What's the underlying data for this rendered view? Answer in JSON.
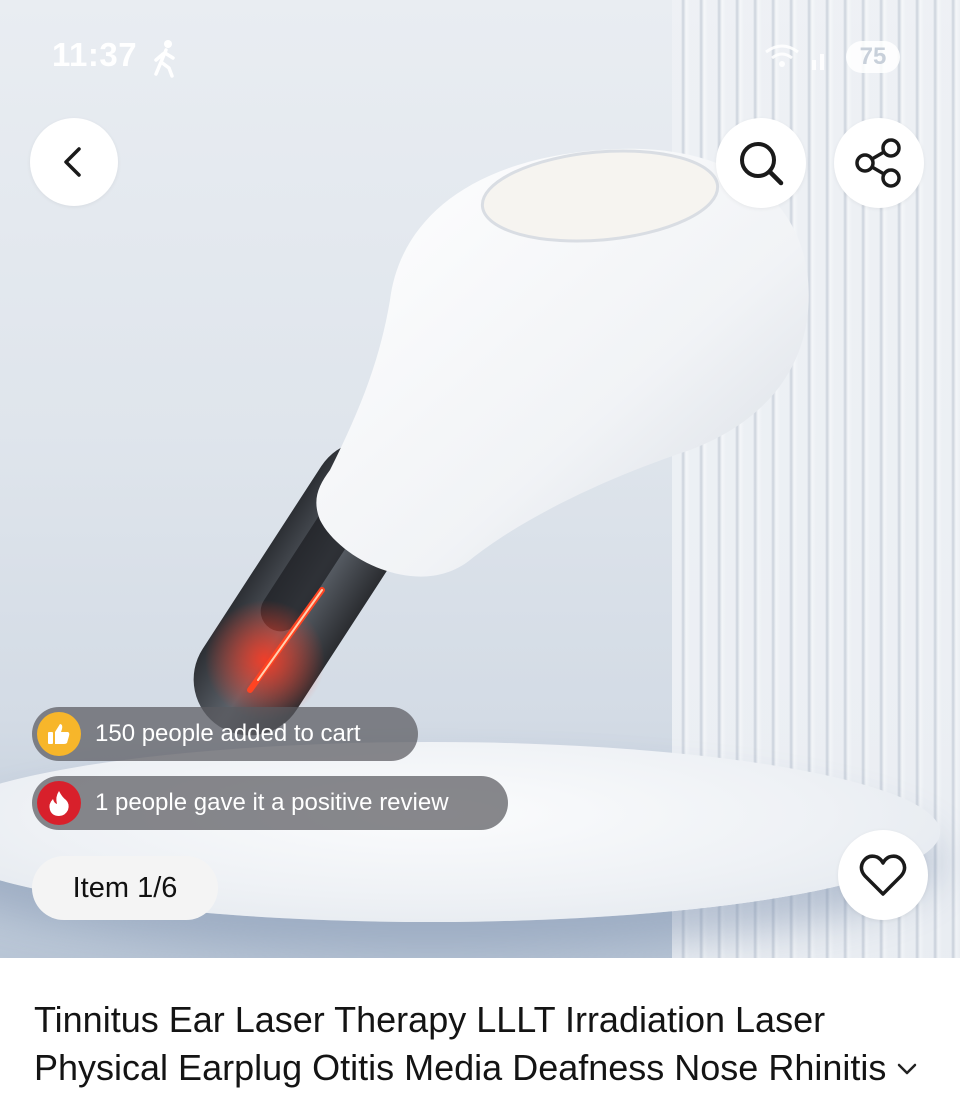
{
  "status_bar": {
    "time": "11:37",
    "activity_icon": "walking-person-icon",
    "wifi_icon": "wifi-icon",
    "signal_icon": "cell-signal-icon",
    "battery": "75"
  },
  "header": {
    "back_icon": "chevron-left-icon",
    "search_icon": "search-icon",
    "share_icon": "share-icon"
  },
  "product_image": {
    "description_icon": "product-photo"
  },
  "badges": {
    "cart_icon": "thumbs-up-icon",
    "cart_text": "150 people added to cart",
    "review_icon": "flame-icon",
    "review_text": "1 people gave it a positive review"
  },
  "gallery": {
    "item_counter": "Item 1/6",
    "favorite_icon": "heart-icon"
  },
  "product": {
    "title": "Tinnitus Ear Laser Therapy LLLT Irradiation Laser Physical Earplug Otitis Media Deafness Nose Rhinitis",
    "expand_icon": "chevron-down-icon"
  },
  "colors": {
    "badge_yellow": "#f7b62a",
    "badge_red": "#d8202b",
    "laser_red": "#ff2a1a"
  }
}
